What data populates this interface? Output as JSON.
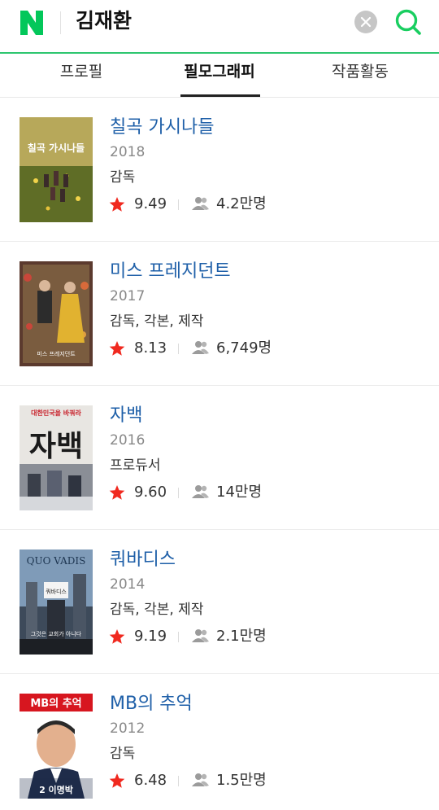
{
  "search": {
    "query": "김재환",
    "clear_icon": "close-icon",
    "submit_icon": "search-icon"
  },
  "brand": {
    "logo_letter": "N",
    "accent": "#2dc66f",
    "link": "#1e5fa8",
    "star": "#f0291f"
  },
  "tabs": [
    {
      "label": "프로필",
      "active": false
    },
    {
      "label": "필모그래피",
      "active": true
    },
    {
      "label": "작품활동",
      "active": false
    }
  ],
  "films": [
    {
      "title": "칠곡 가시나들",
      "year": "2018",
      "role": "감독",
      "rating": "9.49",
      "audience": "4.2만명",
      "poster_text": "칠곡 가시나들"
    },
    {
      "title": "미스 프레지던트",
      "year": "2017",
      "role": "감독, 각본, 제작",
      "rating": "8.13",
      "audience": "6,749명",
      "poster_text": "미스 프레지던트"
    },
    {
      "title": "자백",
      "year": "2016",
      "role": "프로듀서",
      "rating": "9.60",
      "audience": "14만명",
      "poster_text": "자백",
      "poster_banner": "대한민국을 바꿔라"
    },
    {
      "title": "쿼바디스",
      "year": "2014",
      "role": "감독, 각본, 제작",
      "rating": "9.19",
      "audience": "2.1만명",
      "poster_text": "QUO VADIS",
      "poster_sign": "쿼바디스",
      "poster_caption": "그것은 교회가 아니다"
    },
    {
      "title": "MB의 추억",
      "year": "2012",
      "role": "감독",
      "rating": "6.48",
      "audience": "1.5만명",
      "poster_text": "MB의 추억",
      "poster_caption": "2 이명박"
    }
  ]
}
